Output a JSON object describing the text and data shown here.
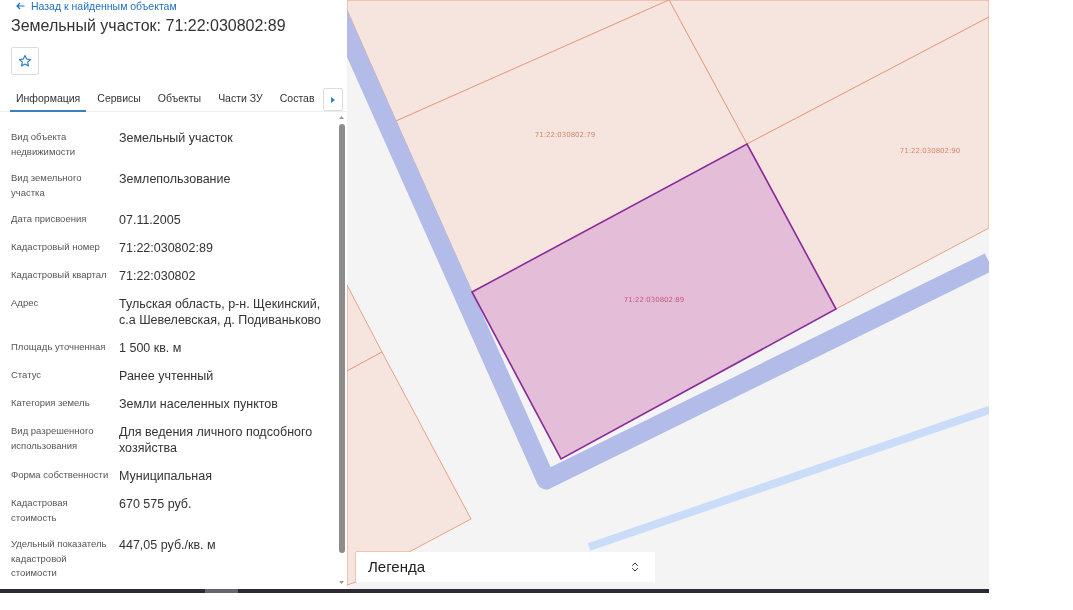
{
  "back_link": {
    "label": "Назад к найденным объектам"
  },
  "title": "Земельный участок: 71:22:030802:89",
  "tabs": [
    {
      "label": "Информация",
      "selected": true
    },
    {
      "label": "Сервисы",
      "selected": false
    },
    {
      "label": "Объекты",
      "selected": false
    },
    {
      "label": "Части ЗУ",
      "selected": false
    },
    {
      "label": "Состав",
      "selected": false
    }
  ],
  "properties": [
    {
      "label": "Вид объекта недвижимости",
      "value": "Земельный участок"
    },
    {
      "label": "Вид земельного участка",
      "value": "Землепользование"
    },
    {
      "label": "Дата присвоения",
      "value": "07.11.2005"
    },
    {
      "label": "Кадастровый номер",
      "value": "71:22:030802:89"
    },
    {
      "label": "Кадастровый квартал",
      "value": "71:22:030802"
    },
    {
      "label": "Адрес",
      "value": "Тульская область, р-н. Щекинский, с.а Шевелевская, д. Подиваньково"
    },
    {
      "label": "Площадь уточненная",
      "value": "1 500 кв. м"
    },
    {
      "label": "Статус",
      "value": "Ранее учтенный"
    },
    {
      "label": "Категория земель",
      "value": "Земли населенных пунктов"
    },
    {
      "label": "Вид разрешенного использования",
      "value": "Для ведения личного подсобного хозяйства"
    },
    {
      "label": "Форма собственности",
      "value": "Муниципальная"
    },
    {
      "label": "Кадастровая стоимость",
      "value": "670 575 руб."
    },
    {
      "label": "Удельный показатель кадастровой стоимости",
      "value": "447,05 руб./кв. м"
    }
  ],
  "map": {
    "parcels": [
      {
        "label": "71:22:030802:79",
        "selected": false
      },
      {
        "label": "71:22:030802:90",
        "selected": false
      },
      {
        "label": "71:22:030802:89",
        "selected": true
      }
    ]
  },
  "legend": {
    "label": "Легенда"
  }
}
